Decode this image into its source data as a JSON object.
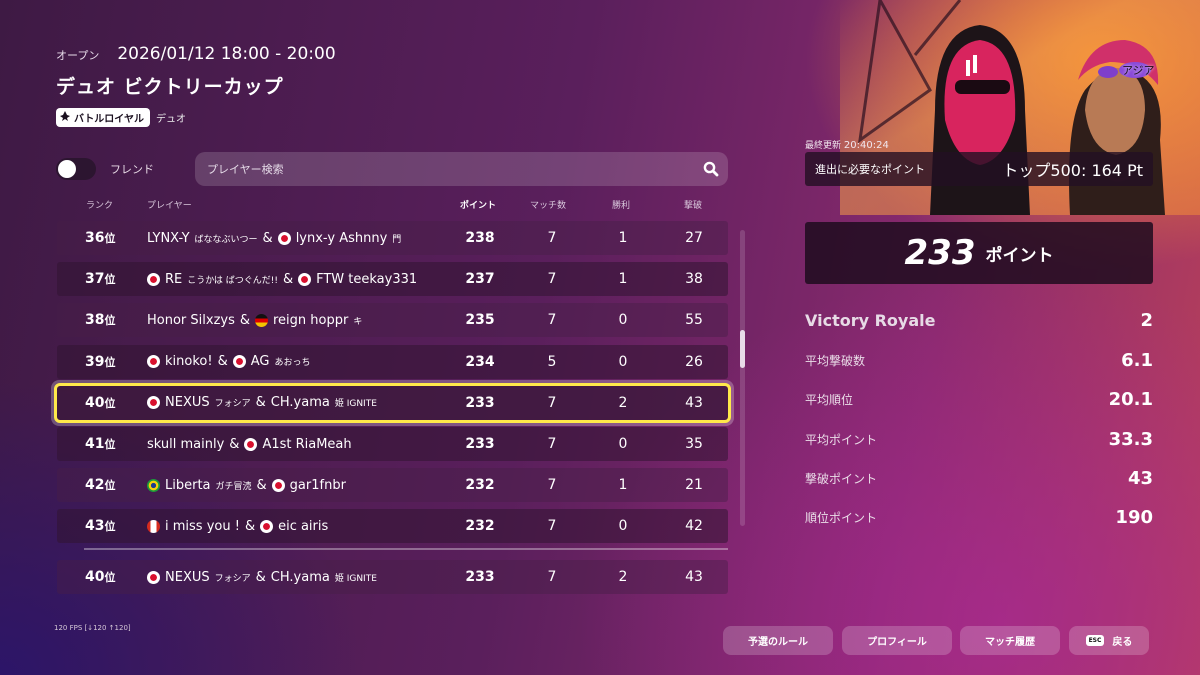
{
  "header": {
    "status": "オープン",
    "schedule": "2026/01/12 18:00 - 20:00",
    "title": "デュオ ビクトリーカップ",
    "mode_chip": "バトルロイヤル",
    "mode_sub": "デュオ"
  },
  "filters": {
    "friend_label": "フレンド",
    "friend_enabled": false,
    "search_placeholder": "プレイヤー検索"
  },
  "columns": {
    "rank": "ランク",
    "player": "プレイヤー",
    "points": "ポイント",
    "matches": "マッチ数",
    "wins": "勝利",
    "eliminations": "撃破"
  },
  "rank_suffix": "位",
  "leaderboard": [
    {
      "rank": "36",
      "players": [
        {
          "flag": "",
          "name": "LYNX-Y",
          "tag": "ばななぶいつー"
        },
        {
          "flag": "jp",
          "name": "lynx-y Äshnny",
          "tag": "門"
        }
      ],
      "points": "238",
      "matches": "7",
      "wins": "1",
      "elims": "27"
    },
    {
      "rank": "37",
      "players": [
        {
          "flag": "jp",
          "name": "RE",
          "tag": "こうかは ばつぐんだ!!"
        },
        {
          "flag": "jp",
          "name": "FTW teekay331",
          "tag": ""
        }
      ],
      "points": "237",
      "matches": "7",
      "wins": "1",
      "elims": "38"
    },
    {
      "rank": "38",
      "players": [
        {
          "flag": "",
          "name": "Honor Silxzys",
          "tag": ""
        },
        {
          "flag": "de",
          "name": "reign hoppr",
          "tag": "キ"
        }
      ],
      "points": "235",
      "matches": "7",
      "wins": "0",
      "elims": "55"
    },
    {
      "rank": "39",
      "players": [
        {
          "flag": "jp",
          "name": "kinoko!",
          "tag": ""
        },
        {
          "flag": "jp",
          "name": "AG",
          "tag": "あおっち"
        }
      ],
      "points": "234",
      "matches": "5",
      "wins": "0",
      "elims": "26"
    },
    {
      "rank": "40",
      "players": [
        {
          "flag": "jp",
          "name": "NEXUS",
          "tag": "フォシア"
        },
        {
          "flag": "",
          "name": "CH.yama",
          "tag": "姫 IGNITE"
        }
      ],
      "points": "233",
      "matches": "7",
      "wins": "2",
      "elims": "43",
      "highlight": true
    },
    {
      "rank": "41",
      "players": [
        {
          "flag": "",
          "name": "skull mainly",
          "tag": ""
        },
        {
          "flag": "jp",
          "name": "A1st RiaMeah",
          "tag": ""
        }
      ],
      "points": "233",
      "matches": "7",
      "wins": "0",
      "elims": "35"
    },
    {
      "rank": "42",
      "players": [
        {
          "flag": "br",
          "name": "Liberta",
          "tag": "ガチ冒涜"
        },
        {
          "flag": "jp",
          "name": "gar1fnbr",
          "tag": ""
        }
      ],
      "points": "232",
      "matches": "7",
      "wins": "1",
      "elims": "21"
    },
    {
      "rank": "43",
      "players": [
        {
          "flag": "ca",
          "name": "i miss you !",
          "tag": ""
        },
        {
          "flag": "jp",
          "name": "eic airis",
          "tag": ""
        }
      ],
      "points": "232",
      "matches": "7",
      "wins": "0",
      "elims": "42"
    }
  ],
  "my_team": {
    "rank": "40",
    "players": [
      {
        "flag": "jp",
        "name": "NEXUS",
        "tag": "フォシア"
      },
      {
        "flag": "",
        "name": "CH.yama",
        "tag": "姫 IGNITE"
      }
    ],
    "points": "233",
    "matches": "7",
    "wins": "2",
    "elims": "43"
  },
  "region": "アジア",
  "summary": {
    "last_updated_label": "最終更新",
    "last_updated_time": "20:40:24",
    "needed_label": "進出に必要なポイント",
    "needed_value": "トップ500: 164 Pt",
    "score": "233",
    "score_unit": "ポイント"
  },
  "stats": [
    {
      "label": "Victory Royale",
      "value": "2",
      "big": true
    },
    {
      "label": "平均撃破数",
      "value": "6.1"
    },
    {
      "label": "平均順位",
      "value": "20.1"
    },
    {
      "label": "平均ポイント",
      "value": "33.3"
    },
    {
      "label": "撃破ポイント",
      "value": "43"
    },
    {
      "label": "順位ポイント",
      "value": "190"
    }
  ],
  "fps_readout": "120 FPS [↓120 ↑120]",
  "footer": {
    "rules": "予選のルール",
    "profile": "プロフィール",
    "history": "マッチ履歴",
    "back": "戻る",
    "esc_key": "ESC"
  },
  "colors": {
    "highlight_border": "#ffe94a",
    "accent_orange": "#f39a3a"
  }
}
